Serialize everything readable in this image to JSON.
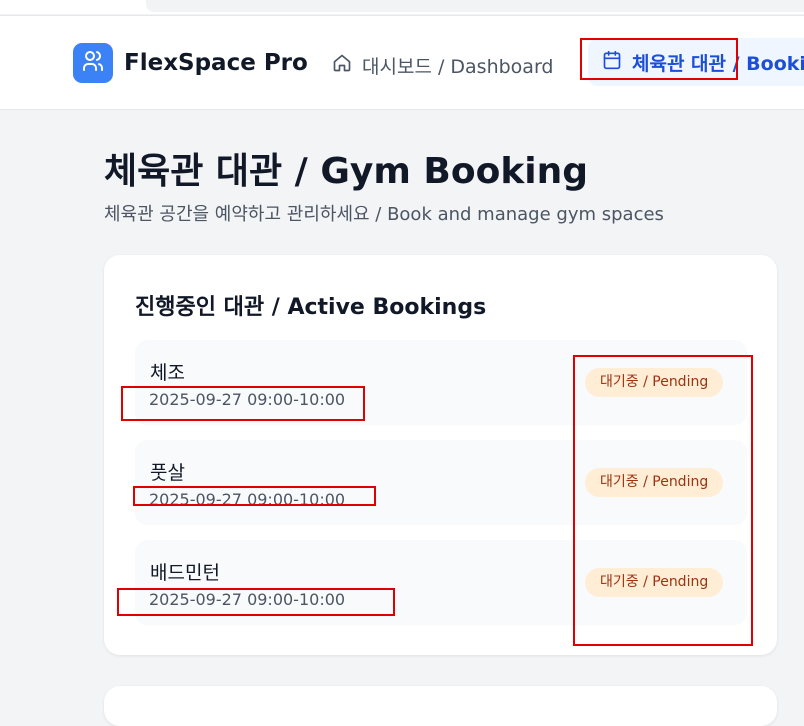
{
  "colors": {
    "brand_blue": "#3b82f6",
    "active_nav": "#1d4ed8",
    "pending_badge_bg": "#ffedd5",
    "pending_badge_text": "#9a3412",
    "highlight_red": "#e00000"
  },
  "header": {
    "brand_name": "FlexSpace Pro",
    "logo_icon": "users-icon",
    "nav": [
      {
        "icon": "home-icon",
        "label": "대시보드 / Dashboard"
      },
      {
        "icon": "calendar-icon",
        "label": "체육관 대관 / Booking",
        "active": true
      }
    ]
  },
  "page": {
    "title": "체육관 대관 / Gym Booking",
    "subtitle": "체육관 공간을 예약하고 관리하세요 / Book and manage gym spaces"
  },
  "active_bookings": {
    "title": "진행중인 대관 / Active Bookings",
    "items": [
      {
        "name": "체조",
        "time": "2025-09-27 09:00-10:00",
        "status": "대기중 / Pending"
      },
      {
        "name": "풋살",
        "time": "2025-09-27 09:00-10:00",
        "status": "대기중 / Pending"
      },
      {
        "name": "배드민턴",
        "time": "2025-09-27 09:00-10:00",
        "status": "대기중 / Pending"
      }
    ]
  }
}
